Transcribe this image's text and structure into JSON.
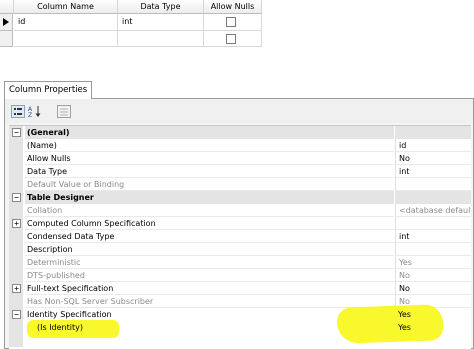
{
  "column_grid": {
    "headers": [
      "Column Name",
      "Data Type",
      "Allow Nulls"
    ],
    "rows": [
      {
        "name": "id",
        "type": "int",
        "allow_nulls": false,
        "selected": true
      },
      {
        "name": "",
        "type": "",
        "allow_nulls": false,
        "selected": false
      }
    ]
  },
  "panel": {
    "tab_label": "Column Properties",
    "toolbar": [
      "categorized-icon",
      "alphabetical-icon",
      "property-pages-icon"
    ]
  },
  "properties": [
    {
      "label": "(General)",
      "category": true,
      "expanded": true
    },
    {
      "label": "(Name)",
      "value": "id"
    },
    {
      "label": "Allow Nulls",
      "value": "No"
    },
    {
      "label": "Data Type",
      "value": "int"
    },
    {
      "label": "Default Value or Binding",
      "value": "",
      "disabled": true
    },
    {
      "label": "Table Designer",
      "category": true,
      "expanded": true
    },
    {
      "label": "Collation",
      "value": "<database default>",
      "disabled": true
    },
    {
      "label": "Computed Column Specification",
      "value": "",
      "expandable": true
    },
    {
      "label": "Condensed Data Type",
      "value": "int"
    },
    {
      "label": "Description",
      "value": ""
    },
    {
      "label": "Deterministic",
      "value": "Yes",
      "disabled": true
    },
    {
      "label": "DTS-published",
      "value": "No",
      "disabled": true
    },
    {
      "label": "Full-text Specification",
      "value": "No",
      "expandable": true
    },
    {
      "label": "Has Non-SQL Server Subscriber",
      "value": "No",
      "disabled": true
    },
    {
      "label": "Identity Specification",
      "value": "Yes",
      "expanded": true
    },
    {
      "label": "(Is Identity)",
      "value": "Yes",
      "indent": true
    }
  ],
  "colors": {
    "highlighter": "#f7f716",
    "category_bg": "#e4e4e4",
    "disabled_text": "#8a8a8a"
  }
}
